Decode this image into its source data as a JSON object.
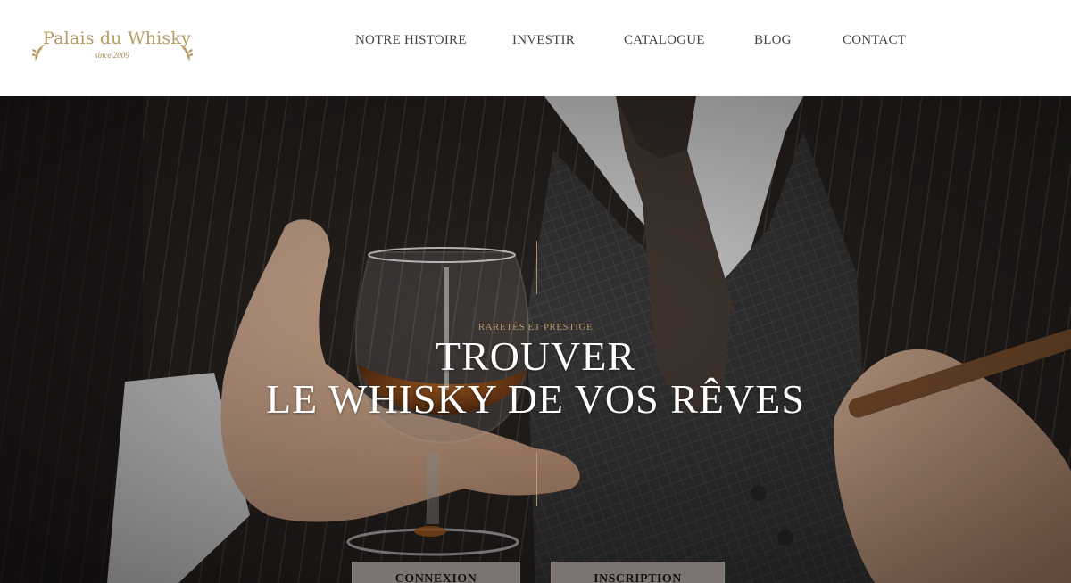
{
  "brand": {
    "name": "Palais du Whisky",
    "tagline": "since 2009",
    "gold": "#b99a63"
  },
  "nav": {
    "items": [
      "NOTRE HISTOIRE",
      "INVESTIR",
      "CATALOGUE",
      "BLOG",
      "CONTACT"
    ]
  },
  "hero": {
    "overline": "RARETÉS ET PRESTIGE",
    "line1": "TROUVER",
    "line2": "LE WHISKY DE VOS RÊVES",
    "login_label": "CONNEXION",
    "signup_label": "INSCRIPTION"
  }
}
